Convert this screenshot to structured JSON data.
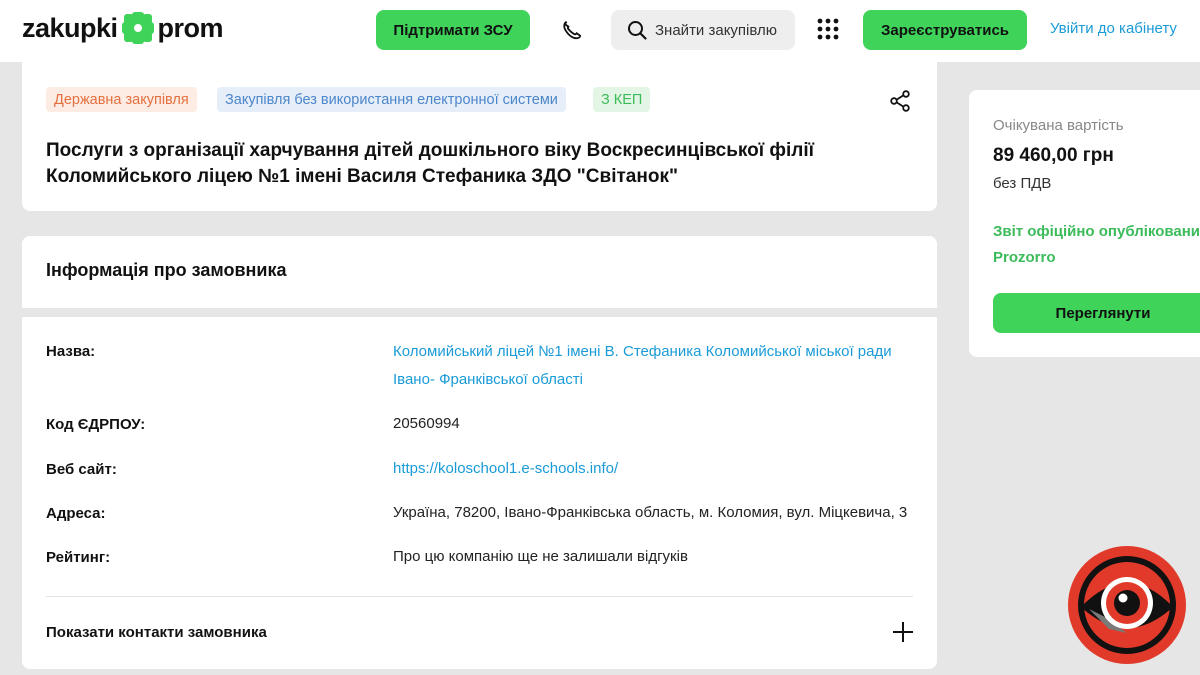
{
  "header": {
    "logo_left": "zakupki",
    "logo_right": "prom",
    "support_button": "Підтримати ЗСУ",
    "search_label": "Знайти закупівлю",
    "register_button": "Зареєструватись",
    "login_link": "Увійти до кабінету",
    "accent_color": "#3fd35a",
    "link_color": "#1a9bd7"
  },
  "tender": {
    "tags": [
      "Державна закупівля",
      "Закупівля без використання електронної системи",
      "З КЕП"
    ],
    "title_line1": "Послуги з організації харчування дітей дошкільного віку Воскресинцівської філії",
    "title_line2": "Коломийського ліцею №1 імені Василя Стефаника ЗДО \"Світанок\""
  },
  "customer": {
    "heading": "Інформація про замовника",
    "rows": [
      {
        "label": "Назва:",
        "value_line1": "Коломийський ліцей №1 імені В. Стефаника Коломийської міської ради",
        "value_line2": "Івано- Франківської області"
      },
      {
        "label": "Код ЄДРПОУ:",
        "value": "20560994"
      },
      {
        "label": "Веб сайт:",
        "value": "https://koloschool1.e-schools.info/"
      },
      {
        "label": "Адреса:",
        "value": "Україна, 78200, Івано-Франківська область, м. Коломия, вул. Міцкевича, 3"
      },
      {
        "label": "Рейтинг:",
        "value": "Про цю компанію ще не залишали відгуків"
      }
    ],
    "contacts_toggle": "Показати контакти замовника"
  },
  "sidebar": {
    "expected_label": "Очікувана вартість",
    "price": "89 460,00 грн",
    "vat": "без ПДВ",
    "report_line1": "Звіт офіційно опублікований",
    "report_line2": "Prozorro",
    "view_button": "Переглянути"
  },
  "icons": [
    "logo-cross-icon",
    "phone-icon",
    "search-icon",
    "apps-grid-icon",
    "share-icon",
    "plus-icon",
    "eye-badge-icon"
  ]
}
